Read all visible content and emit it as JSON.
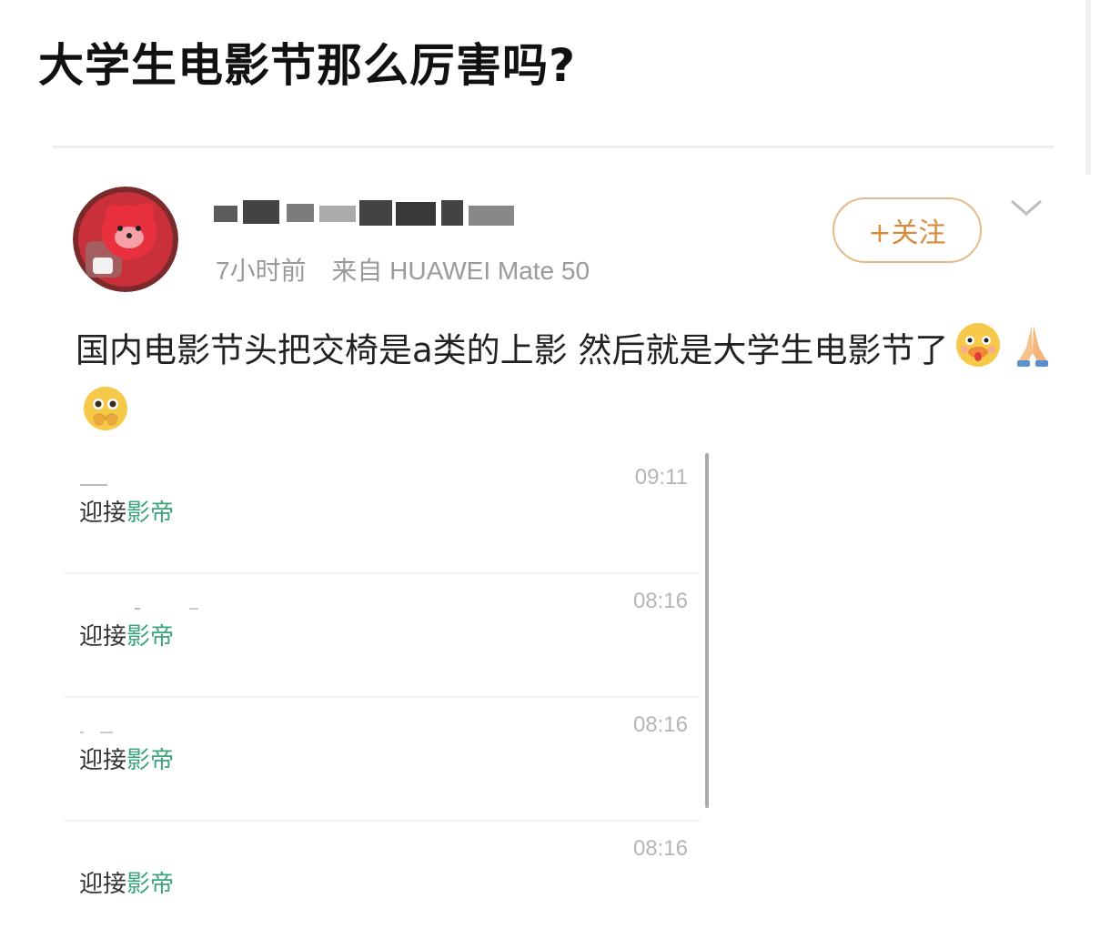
{
  "page_title": "大学生电影节那么厉害吗?",
  "post": {
    "username": "",
    "time": "7小时前",
    "source": "来自 HUAWEI Mate 50",
    "follow_label": "+关注",
    "text": "国内电影节头把交椅是a类的上影 然后就是大学生电影节了",
    "emojis": [
      "duck-face-emoji",
      "folded-hands-emoji",
      "pleading-face-emoji"
    ]
  },
  "comments": [
    {
      "time": "09:11",
      "prefix": "迎接",
      "highlight": "影帝"
    },
    {
      "time": "08:16",
      "prefix": "迎接",
      "highlight": "影帝"
    },
    {
      "time": "08:16",
      "prefix": "迎接",
      "highlight": "影帝"
    },
    {
      "time": "08:16",
      "prefix": "迎接",
      "highlight": "影帝"
    }
  ],
  "colors": {
    "follow_accent": "#d88a3b",
    "highlight_green": "#3aa57a"
  }
}
